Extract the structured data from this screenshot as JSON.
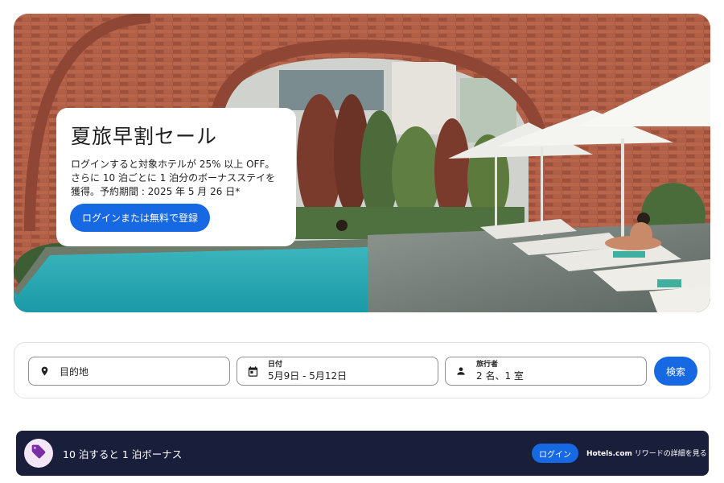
{
  "promo": {
    "title": "夏旅早割セール",
    "body": "ログインすると対象ホテルが 25% 以上 OFF。さらに 10 泊ごとに 1 泊分のボーナスステイを獲得。予約期間 : 2025 年 5 月 26 日*",
    "cta_label": "ログインまたは無料で登録"
  },
  "search": {
    "destination": {
      "placeholder": "目的地",
      "icon": "location-pin-icon"
    },
    "dates": {
      "label": "日付",
      "value": "5月9日 - 5月12日",
      "icon": "calendar-icon"
    },
    "travelers": {
      "label": "旅行者",
      "value": "2 名、1 室",
      "icon": "person-icon"
    },
    "button_label": "検索"
  },
  "rewards": {
    "icon": "price-tag-icon",
    "text": "10 泊すると 1 泊ボーナス",
    "login_label": "ログイン",
    "link_brand": "Hotels.com",
    "link_text": " リワードの詳細を見る"
  },
  "colors": {
    "primary": "#1668e3",
    "banner_bg": "#191e3b",
    "badge_bg": "#f3e6f7",
    "badge_icon": "#7b2fa6"
  }
}
